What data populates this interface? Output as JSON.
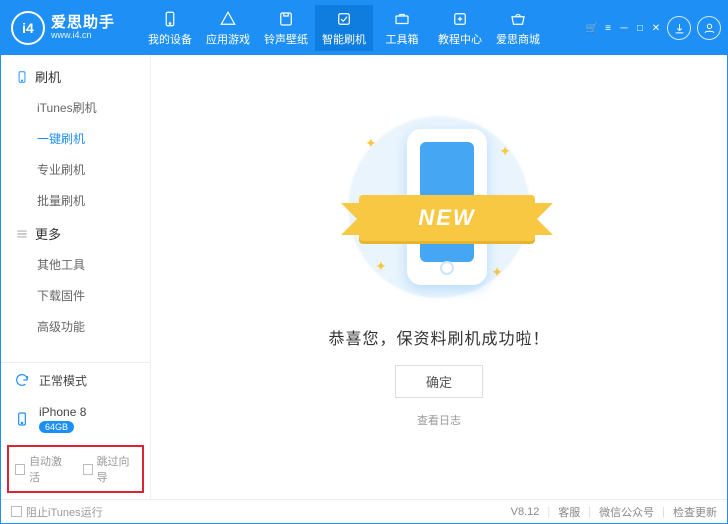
{
  "brand": {
    "cn": "爱思助手",
    "en": "www.i4.cn",
    "logo_text": "i4"
  },
  "nav": [
    {
      "label": "我的设备"
    },
    {
      "label": "应用游戏"
    },
    {
      "label": "铃声壁纸"
    },
    {
      "label": "智能刷机"
    },
    {
      "label": "工具箱"
    },
    {
      "label": "教程中心"
    },
    {
      "label": "爱思商城"
    }
  ],
  "nav_active_index": 3,
  "sidebar": {
    "sections": [
      {
        "title": "刷机",
        "items": [
          "iTunes刷机",
          "一键刷机",
          "专业刷机",
          "批量刷机"
        ],
        "active_index": 1
      },
      {
        "title": "更多",
        "items": [
          "其他工具",
          "下载固件",
          "高级功能"
        ],
        "active_index": -1
      }
    ],
    "mode_label": "正常模式",
    "device_name": "iPhone 8",
    "device_storage": "64GB",
    "checkbox1": "自动激活",
    "checkbox2": "跳过向导"
  },
  "main": {
    "ribbon": "NEW",
    "message": "恭喜您，保资料刷机成功啦！",
    "ok": "确定",
    "log_link": "查看日志"
  },
  "status": {
    "block_itunes": "阻止iTunes运行",
    "version": "V8.12",
    "links": [
      "客服",
      "微信公众号",
      "检查更新"
    ]
  }
}
